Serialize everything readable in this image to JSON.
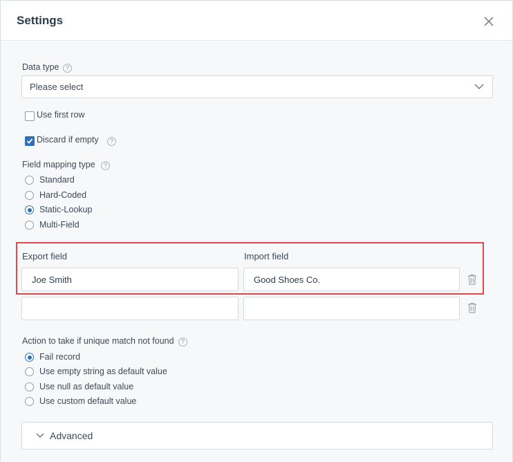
{
  "dialog": {
    "title": "Settings"
  },
  "data_type": {
    "label": "Data type",
    "help": "?",
    "value": "Please select"
  },
  "checkboxes": [
    {
      "label": "Use first row",
      "checked": false
    },
    {
      "label": "Discard if empty",
      "checked": true,
      "help": "?"
    }
  ],
  "field_mapping": {
    "label": "Field mapping type",
    "help": "?",
    "options": [
      "Standard",
      "Hard-Coded",
      "Static-Lookup",
      "Multi-Field"
    ],
    "selected": "Static-Lookup"
  },
  "mapping_table": {
    "export_header": "Export field",
    "import_header": "Import field",
    "rows": [
      {
        "export": "Joe Smith",
        "import": "Good Shoes Co."
      },
      {
        "export": "",
        "import": ""
      }
    ]
  },
  "unique_match": {
    "label": "Action to take if unique match not found",
    "help": "?",
    "options": [
      "Fail record",
      "Use empty string as default value",
      "Use null as default value",
      "Use custom default value"
    ],
    "selected": "Fail record"
  },
  "advanced": {
    "label": "Advanced"
  },
  "colors": {
    "accent": "#2d6fb8",
    "highlight": "#e2474b",
    "body_bg": "#f7f8fa"
  }
}
